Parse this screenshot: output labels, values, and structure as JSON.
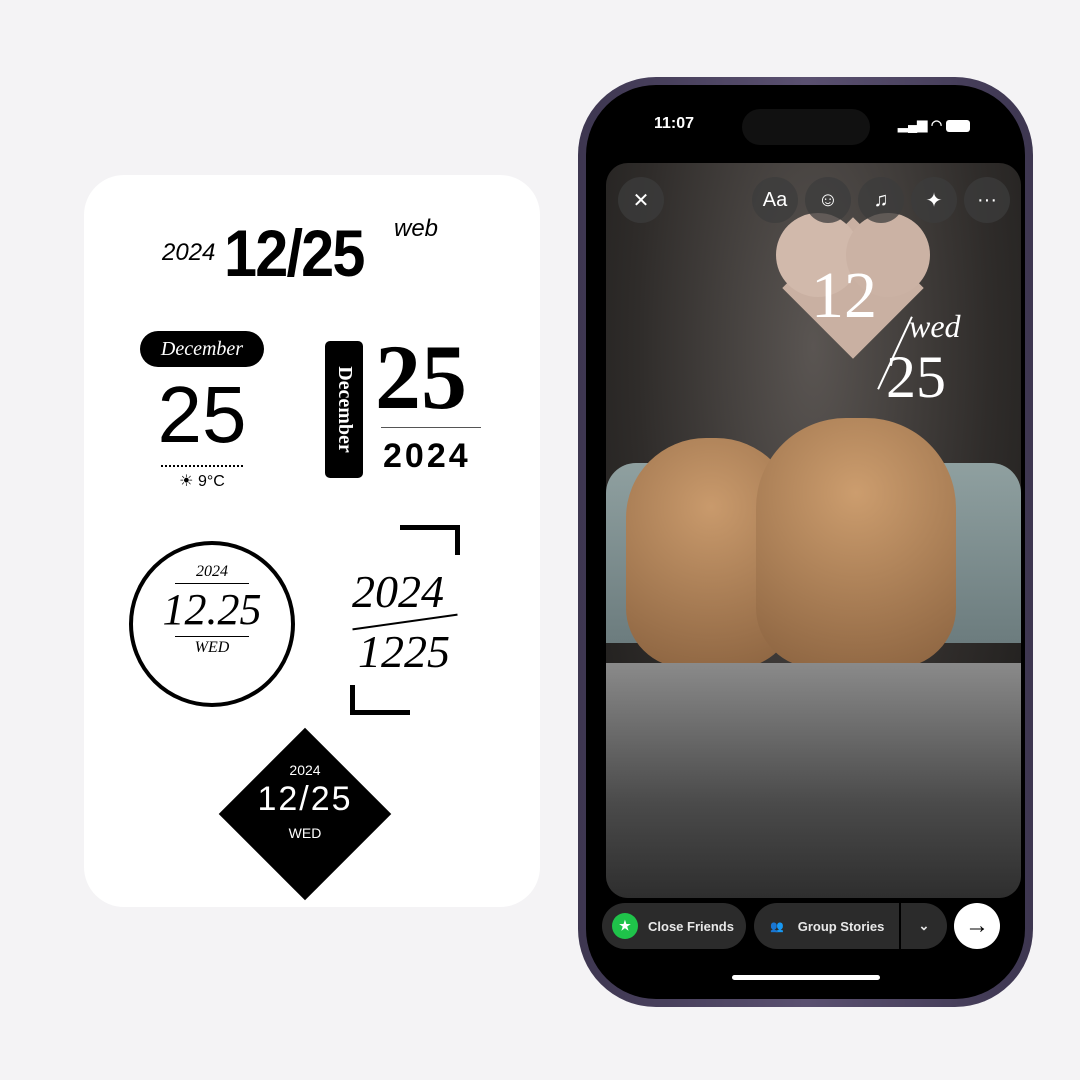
{
  "stickers": {
    "s1": {
      "year": "2024",
      "date": "12/25",
      "day": "web"
    },
    "s2": {
      "month": "December",
      "day": "25",
      "weather": "9°C",
      "weather_icon": "sun-icon"
    },
    "s3": {
      "month": "December",
      "day": "25",
      "year": "2024"
    },
    "s4": {
      "year": "2024",
      "date": "12.25",
      "weekday": "WED"
    },
    "s5": {
      "year": "2024",
      "date": "1225"
    },
    "s6": {
      "year": "2024",
      "date": "12/25",
      "weekday": "WED"
    }
  },
  "phone": {
    "status": {
      "time": "11:07"
    },
    "toolbar": {
      "close": "✕",
      "text": "Aa",
      "more": "···"
    },
    "sticker": {
      "month": "12",
      "weekday": "wed",
      "day": "25"
    },
    "bottom": {
      "close_friends": "Close Friends",
      "group_stories": "Group Stories"
    },
    "colors": {
      "close_friends": "#1fc34a",
      "frame": "#4a4260"
    }
  }
}
